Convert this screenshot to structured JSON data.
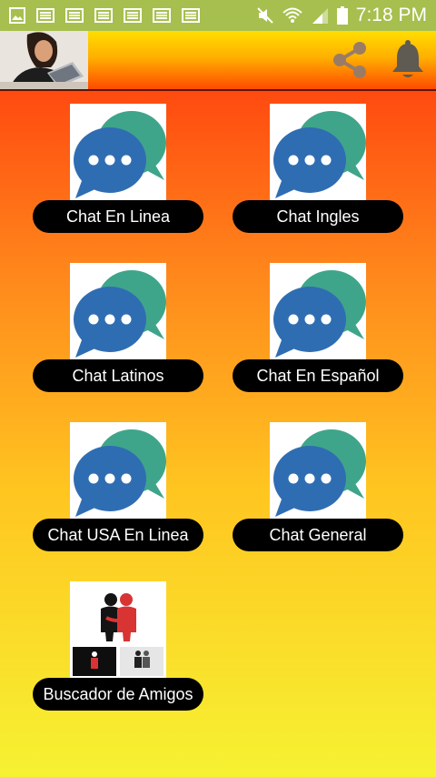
{
  "status_bar": {
    "time": "7:18 PM",
    "notification_icons": [
      "image-icon",
      "message-icon",
      "message-icon",
      "message-icon",
      "message-icon",
      "message-icon",
      "message-icon"
    ],
    "system_icons": [
      "mute-icon",
      "wifi-icon",
      "signal-icon",
      "battery-icon"
    ]
  },
  "app_bar": {
    "logo_icon": "woman-with-laptop-photo",
    "actions": [
      "share-icon",
      "bell-icon"
    ]
  },
  "tiles": [
    {
      "label": "Chat En Linea",
      "icon": "chat-bubbles-icon"
    },
    {
      "label": "Chat Ingles",
      "icon": "chat-bubbles-icon"
    },
    {
      "label": "Chat Latinos",
      "icon": "chat-bubbles-icon"
    },
    {
      "label": "Chat En Español",
      "icon": "chat-bubbles-icon"
    },
    {
      "label": "Chat USA En Linea",
      "icon": "chat-bubbles-icon"
    },
    {
      "label": "Chat General",
      "icon": "chat-bubbles-icon"
    },
    {
      "label": "Buscador de Amigos",
      "icon": "friends-icon"
    }
  ],
  "colors": {
    "status_bar": "#a7bf4e",
    "bubble_front": "#2f6db3",
    "bubble_back": "#3fa58a",
    "label_background": "#000000",
    "background_top": "#ff4a10",
    "background_bottom": "#f6f232"
  }
}
